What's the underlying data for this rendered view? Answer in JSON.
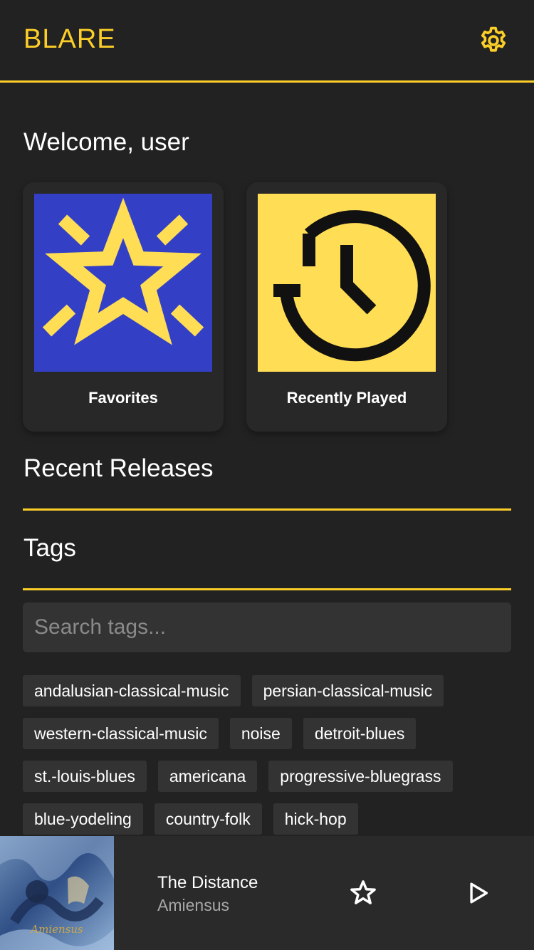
{
  "app": {
    "title": "BLARE",
    "accent": "#fcce28",
    "background": "#222222"
  },
  "header": {
    "settings_icon": "gear-icon"
  },
  "welcome": {
    "text": "Welcome, user"
  },
  "cards": [
    {
      "label": "Favorites",
      "icon": "star-icon",
      "bg": "#3340c6"
    },
    {
      "label": "Recently Played",
      "icon": "history-clock-icon",
      "bg": "#ffdd55"
    }
  ],
  "sections": {
    "recent_releases": "Recent Releases",
    "tags": "Tags"
  },
  "search": {
    "placeholder": "Search tags..."
  },
  "tags": [
    "andalusian-classical-music",
    "persian-classical-music",
    "western-classical-music",
    "noise",
    "detroit-blues",
    "st.-louis-blues",
    "americana",
    "progressive-bluegrass",
    "blue-yodeling",
    "country-folk",
    "hick-hop"
  ],
  "player": {
    "title": "The Distance",
    "artist": "Amiensus",
    "cover_text": "Amiensus",
    "favorite_icon": "star-outline-icon",
    "play_icon": "play-icon"
  }
}
